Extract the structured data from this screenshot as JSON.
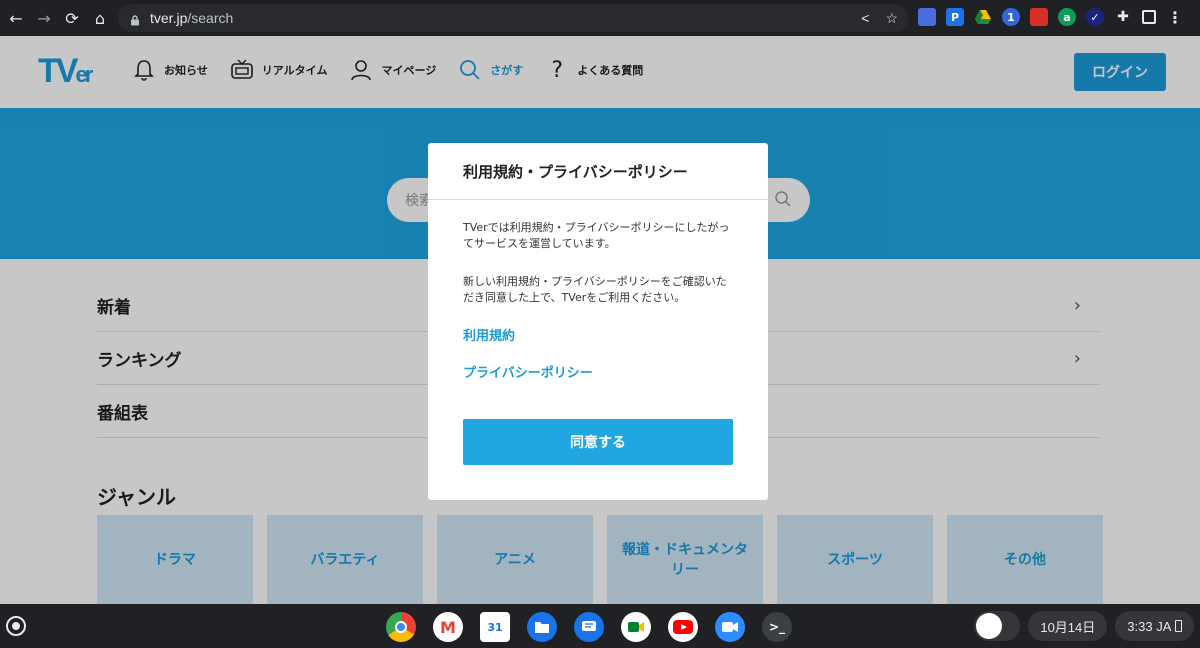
{
  "browser": {
    "url_host": "tver.jp",
    "url_path": "/search"
  },
  "header": {
    "logo_main": "TV",
    "logo_rest": "er",
    "nav": [
      {
        "label": "お知らせ",
        "icon": "bell-icon"
      },
      {
        "label": "リアルタイム",
        "icon": "tv-icon"
      },
      {
        "label": "マイページ",
        "icon": "person-icon"
      },
      {
        "label": "さがす",
        "icon": "search-icon"
      },
      {
        "label": "よくある質問",
        "icon": "question-icon"
      }
    ],
    "login_label": "ログイン"
  },
  "search": {
    "placeholder": "検索"
  },
  "menu": [
    {
      "label": "新着"
    },
    {
      "label": "ランキング"
    },
    {
      "label": "番組表"
    }
  ],
  "genre_title": "ジャンル",
  "genres": [
    "ドラマ",
    "バラエティ",
    "アニメ",
    "報道・ドキュメンタリー",
    "スポーツ",
    "その他"
  ],
  "modal": {
    "title": "利用規約・プライバシーポリシー",
    "text1": "TVerでは利用規約・プライバシーポリシーにしたがってサービスを運営しています。",
    "text2": "新しい利用規約・プライバシーポリシーをご確認いただき同意した上で、TVerをご利用ください。",
    "link_terms": "利用規約",
    "link_privacy": "プライバシーポリシー",
    "agree_label": "同意する"
  },
  "shelf": {
    "date": "10月14日",
    "time": "3:33",
    "ime": "JA"
  },
  "colors": {
    "accent": "#21a6e0",
    "brand": "#1b9bd9"
  }
}
